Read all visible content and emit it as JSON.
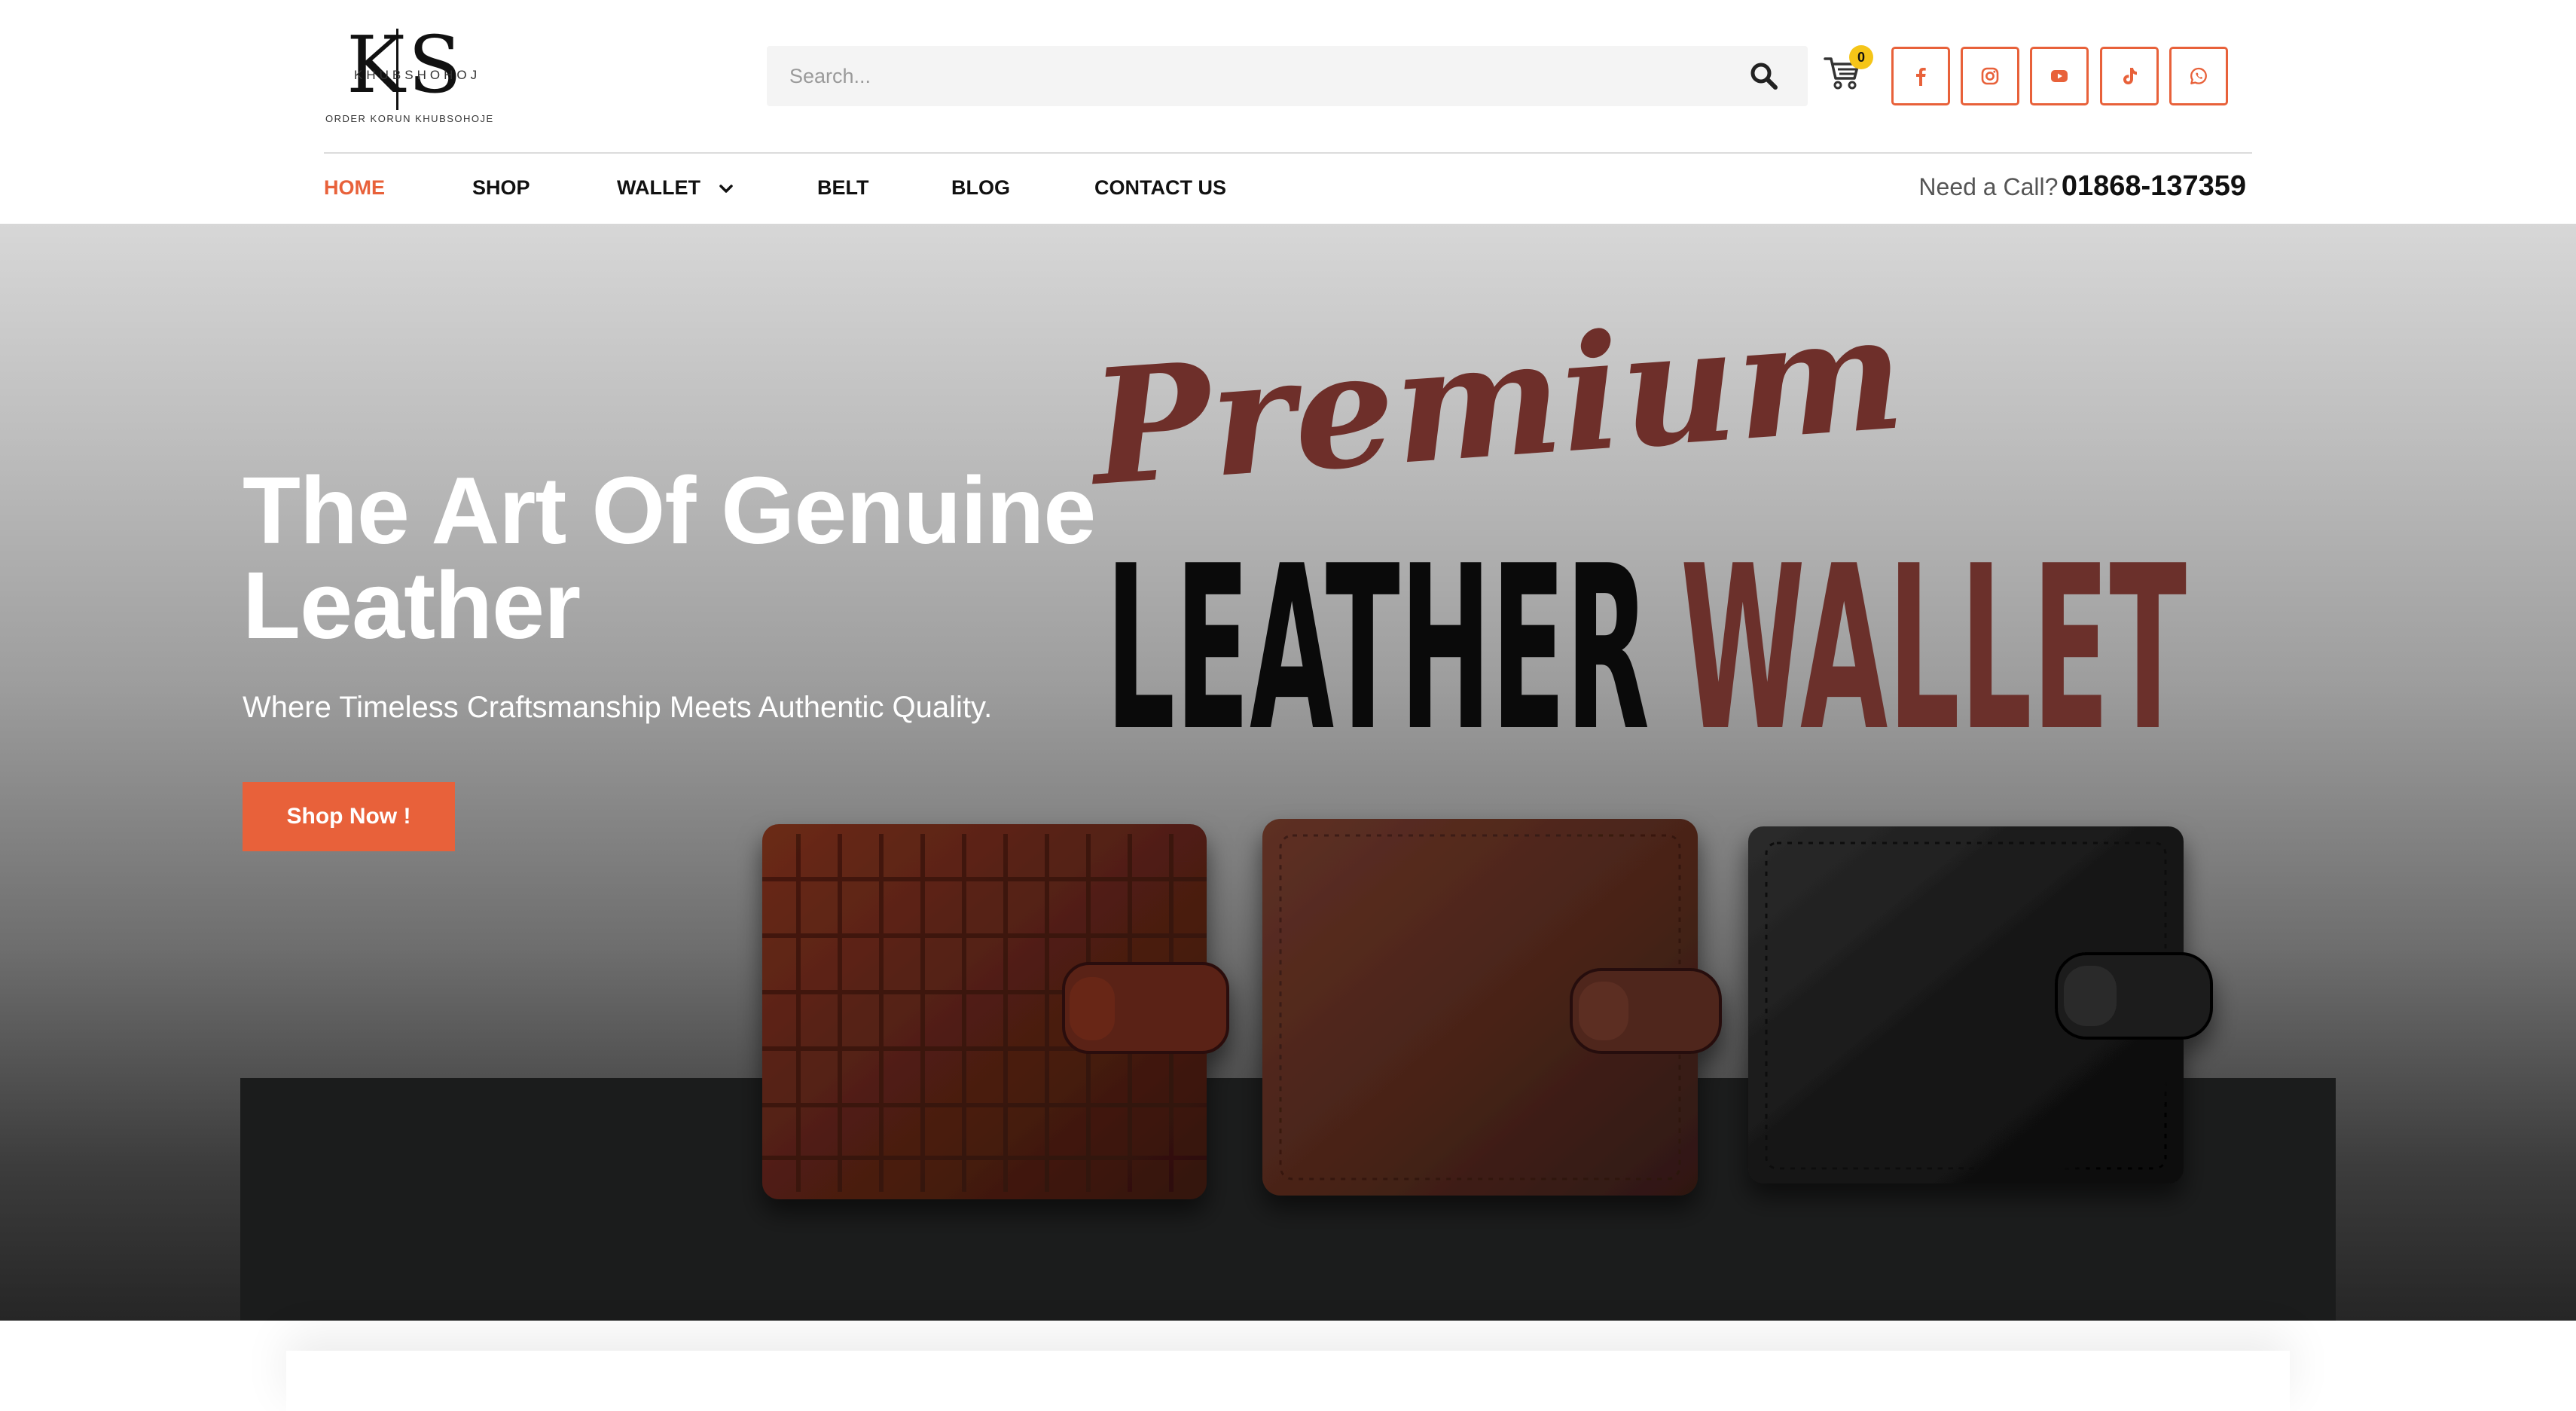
{
  "header": {
    "logo": {
      "monogram": "KS",
      "arc_text": "KHUBSHOHOJ",
      "tagline": "ORDER KORUN KHUBSOHOJE"
    },
    "search": {
      "placeholder": "Search..."
    },
    "cart": {
      "count": "0"
    },
    "social": [
      "facebook-icon",
      "instagram-icon",
      "youtube-icon",
      "tiktok-icon",
      "whatsapp-icon"
    ],
    "accent": "#e8613a"
  },
  "nav": {
    "items": [
      {
        "label": "HOME",
        "active": true
      },
      {
        "label": "SHOP"
      },
      {
        "label": "WALLET"
      },
      {
        "label": "BELT"
      },
      {
        "label": "BLOG"
      },
      {
        "label": "CONTACT US"
      }
    ],
    "call_label": "Need a Call?",
    "call_number": "01868-137359"
  },
  "hero": {
    "title": "The Art Of Genuine Leather",
    "subtitle": "Where Timeless Craftsmanship Meets Authentic Quality.",
    "cta": "Shop Now !",
    "banner": {
      "script_word": "Premium",
      "word1": "LEATHER",
      "word2": "WALLET",
      "script_color": "#6e2f2a",
      "word1_color": "#0a0a0a",
      "word2_color": "#6b302b"
    },
    "products": [
      "brown croc wallet",
      "brown pebbled wallet",
      "black wallet"
    ]
  }
}
